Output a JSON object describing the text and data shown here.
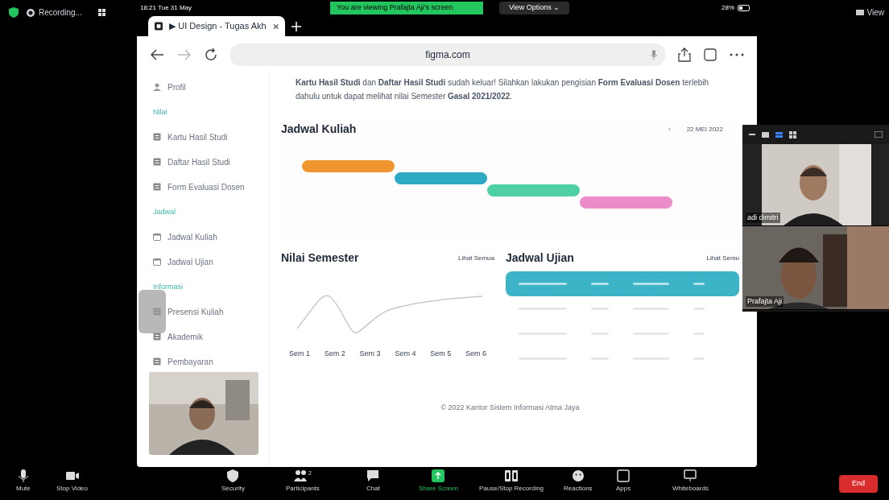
{
  "meeting": {
    "recording": "Recording...",
    "banner": "You are viewing Prafajta Aji's screen",
    "view_options": "View Options ⌄",
    "view": "View"
  },
  "ipad_status": {
    "time": "18:21 Tue 31 May",
    "battery": "28%"
  },
  "browser": {
    "tab_title": "▶ UI Design - Tugas Akh",
    "url": "figma.com"
  },
  "sidebar": [
    {
      "kind": "profile",
      "label": "Profil"
    },
    {
      "kind": "heading",
      "label": "Nilai"
    },
    {
      "kind": "document",
      "label": "Kartu Hasil Studi"
    },
    {
      "kind": "document",
      "label": "Daftar Hasil Studi"
    },
    {
      "kind": "document",
      "label": "Form Evaluasi Dosen"
    },
    {
      "kind": "heading",
      "label": "Jadwal"
    },
    {
      "kind": "schedule",
      "label": "Jadwal Kuliah"
    },
    {
      "kind": "schedule",
      "label": "Jadwal Ujian"
    },
    {
      "kind": "heading",
      "label": "Informasi"
    },
    {
      "kind": "document",
      "label": "Presensi Kuliah"
    },
    {
      "kind": "document",
      "label": "Akademik"
    },
    {
      "kind": "document",
      "label": "Pembayaran"
    }
  ],
  "notice": "**Kartu Hasil Studi** dan **Daftar Hasil Studi** sudah keluar! Silahkan lakukan pengisian **Form Evaluasi Dosen** terlebih dahulu untuk dapat melihat nilai Semester **Gasal 2021/2022**.",
  "schedule": {
    "title": "Jadwal Kuliah",
    "prev": "‹",
    "date": "22 MEI 2022",
    "bars": [
      {
        "color": "#f0962e"
      },
      {
        "color": "#2ea9c4"
      },
      {
        "color": "#4fcfa5"
      },
      {
        "color": "#ec8cc9"
      }
    ]
  },
  "grades": {
    "title": "Nilai Semester",
    "link": "Lihat Semua",
    "x_labels": [
      "Sem 1",
      "Sem 2",
      "Sem 3",
      "Sem 4",
      "Sem 5",
      "Sem 6"
    ]
  },
  "exams": {
    "title": "Jadwal Ujian",
    "link": "Lihat Semu",
    "rows": [
      {
        "selected": true
      },
      {
        "selected": false
      },
      {
        "selected": false
      },
      {
        "selected": false
      }
    ]
  },
  "footer": "© 2022 Kantor Sistem Informasi Atma Jaya",
  "participants": [
    {
      "name": "adi dimitri"
    },
    {
      "name": "Prafajta Aji"
    }
  ],
  "toolbar": [
    {
      "kind": "mic",
      "label": "Mute"
    },
    {
      "kind": "video",
      "label": "Stop Video"
    },
    {
      "kind": "shield",
      "label": "Security"
    },
    {
      "kind": "people",
      "label": "Participants",
      "count": "2"
    },
    {
      "kind": "chat",
      "label": "Chat"
    },
    {
      "kind": "share",
      "label": "Share Screen"
    },
    {
      "kind": "record",
      "label": "Pause/Stop Recording"
    },
    {
      "kind": "smile",
      "label": "Reactions"
    },
    {
      "kind": "apps",
      "label": "Apps"
    },
    {
      "kind": "board",
      "label": "Whiteboards"
    }
  ],
  "end": "End"
}
